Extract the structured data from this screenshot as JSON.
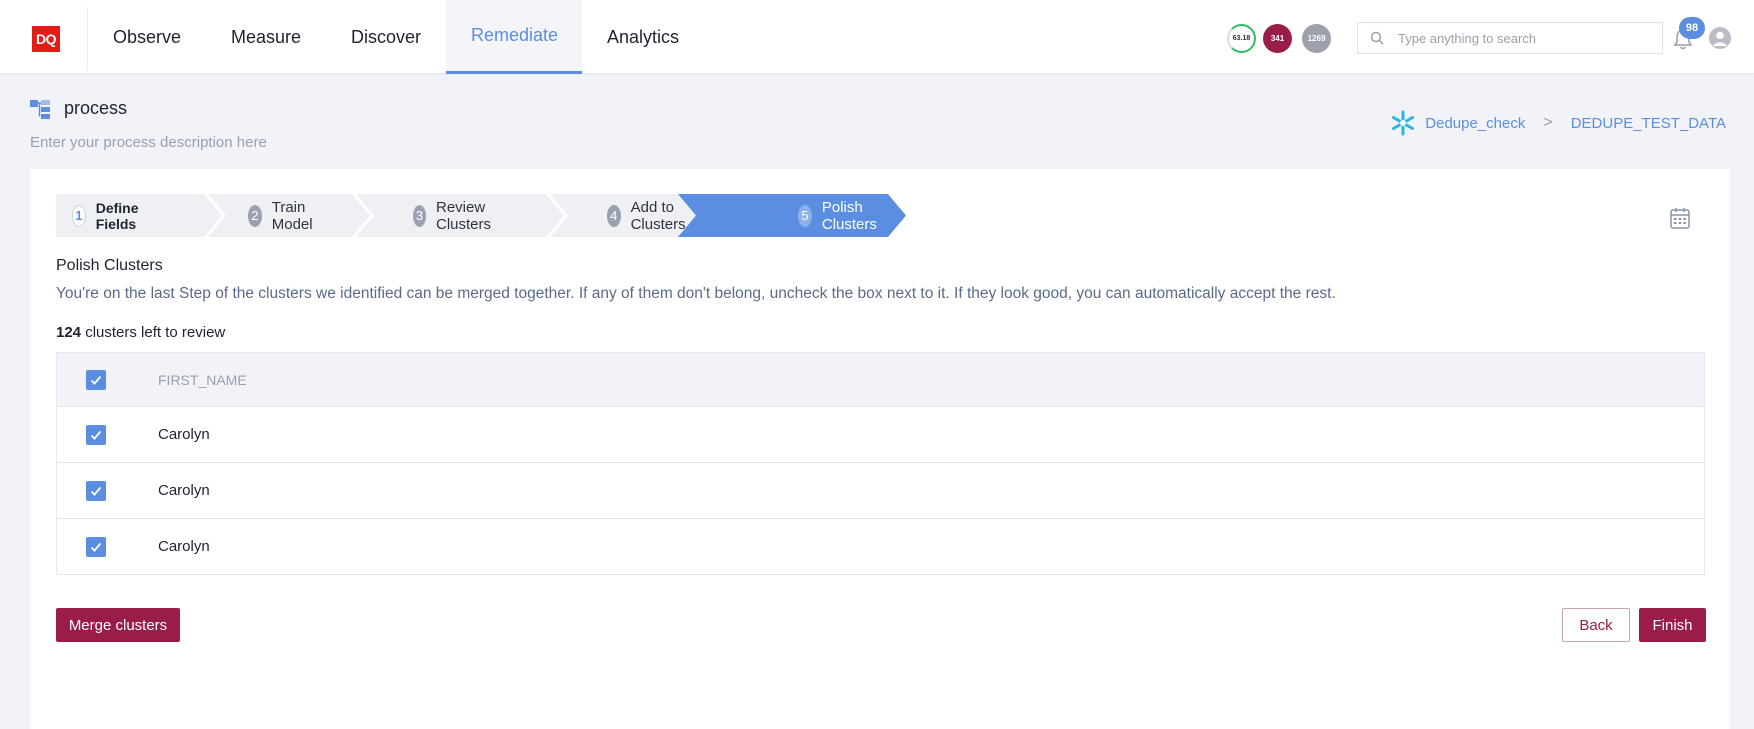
{
  "nav": {
    "logo": "DQ",
    "items": [
      "Observe",
      "Measure",
      "Discover",
      "Remediate",
      "Analytics"
    ],
    "active": "Remediate"
  },
  "scores": [
    "63.18",
    "341",
    "1269"
  ],
  "search": {
    "placeholder": "Type anything to search"
  },
  "notifications": {
    "count": "98"
  },
  "process": {
    "title": "process",
    "description": "Enter your process description here"
  },
  "breadcrumb": {
    "items": [
      "Dedupe_check",
      "DEDUPE_TEST_DATA"
    ],
    "separator": ">"
  },
  "steps": [
    {
      "num": "1",
      "label": "Define Fields"
    },
    {
      "num": "2",
      "label": "Train Model"
    },
    {
      "num": "3",
      "label": "Review Clusters"
    },
    {
      "num": "4",
      "label": "Add to Clusters"
    },
    {
      "num": "5",
      "label": "Polish Clusters"
    }
  ],
  "polish": {
    "title": "Polish Clusters",
    "description": "You're on the last Step of the clusters we identified can be merged together. If any of them don't belong, uncheck the box next to it. If they look good, you can automatically accept the rest.",
    "count": "124",
    "count_label": " clusters left to review"
  },
  "table": {
    "header": "FIRST_NAME",
    "rows": [
      "Carolyn",
      "Carolyn",
      "Carolyn"
    ]
  },
  "buttons": {
    "merge": "Merge clusters",
    "back": "Back",
    "finish": "Finish"
  },
  "colors": {
    "accent": "#5b8ee0",
    "brand": "#9a1c48",
    "logo": "#e41b17"
  }
}
